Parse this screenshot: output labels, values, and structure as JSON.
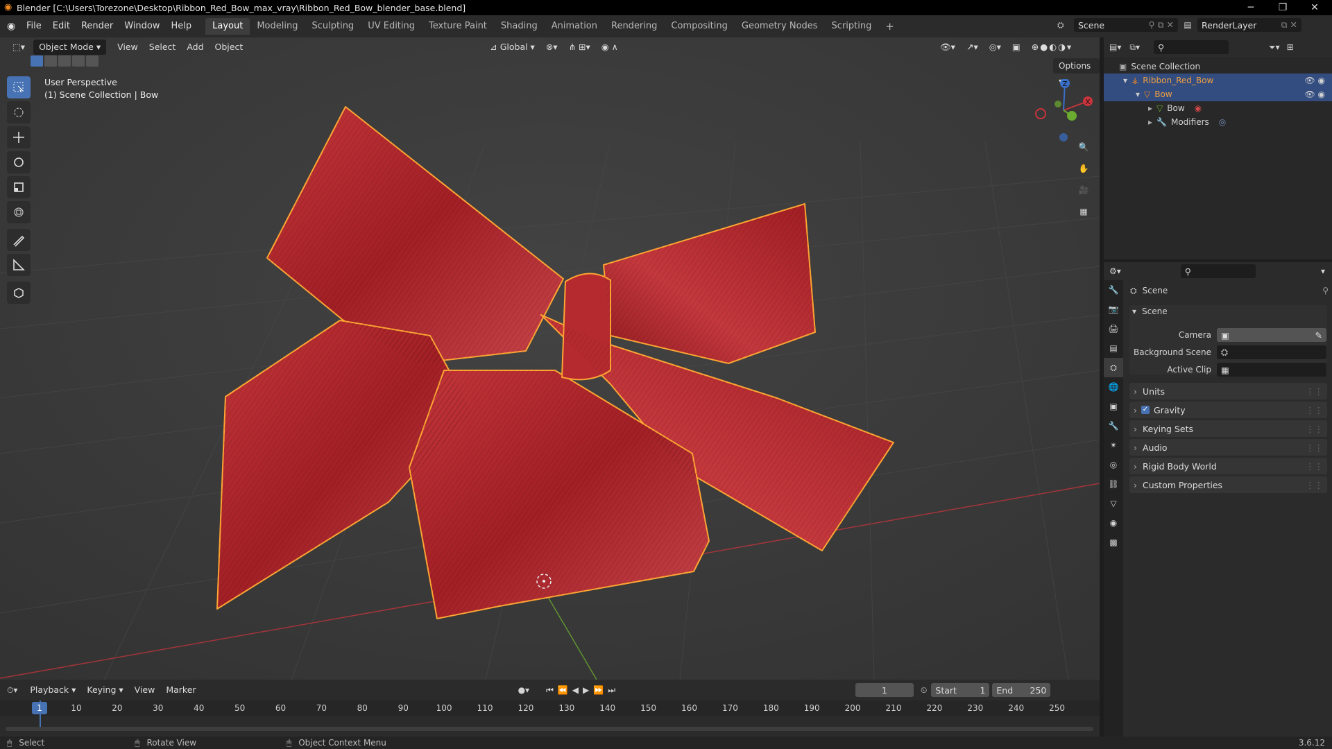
{
  "window": {
    "title": "Blender [C:\\Users\\Torezone\\Desktop\\Ribbon_Red_Bow_max_vray\\Ribbon_Red_Bow_blender_base.blend]"
  },
  "menus": [
    "File",
    "Edit",
    "Render",
    "Window",
    "Help"
  ],
  "workspaces": [
    "Layout",
    "Modeling",
    "Sculpting",
    "UV Editing",
    "Texture Paint",
    "Shading",
    "Animation",
    "Rendering",
    "Compositing",
    "Geometry Nodes",
    "Scripting"
  ],
  "active_workspace": "Layout",
  "scene_name": "Scene",
  "view_layer": "RenderLayer",
  "viewport": {
    "mode": "Object Mode",
    "menus": [
      "View",
      "Select",
      "Add",
      "Object"
    ],
    "orientation": "Global",
    "options": "Options",
    "overlay_title": "User Perspective",
    "overlay_sub": "(1) Scene Collection | Bow",
    "gizmo": {
      "x": "X",
      "y": "Y",
      "z": "Z"
    }
  },
  "outliner": {
    "root": "Scene Collection",
    "items": [
      {
        "label": "Ribbon_Red_Bow",
        "selected": true
      },
      {
        "label": "Bow",
        "selected": true
      },
      {
        "label": "Bow"
      },
      {
        "label": "Modifiers"
      }
    ]
  },
  "properties": {
    "header": "Scene",
    "section": "Scene",
    "fields": [
      {
        "label": "Camera",
        "value": ""
      },
      {
        "label": "Background Scene",
        "value": ""
      },
      {
        "label": "Active Clip",
        "value": ""
      }
    ],
    "panels": [
      "Units",
      "Gravity",
      "Keying Sets",
      "Audio",
      "Rigid Body World",
      "Custom Properties"
    ],
    "gravity_checked": true
  },
  "timeline": {
    "menus": [
      "Playback",
      "Keying",
      "View",
      "Marker"
    ],
    "current_frame": "1",
    "start_label": "Start",
    "start": "1",
    "end_label": "End",
    "end": "250",
    "ticks": [
      "1",
      "10",
      "20",
      "30",
      "40",
      "50",
      "60",
      "70",
      "80",
      "90",
      "100",
      "110",
      "120",
      "130",
      "140",
      "150",
      "160",
      "170",
      "180",
      "190",
      "200",
      "210",
      "220",
      "230",
      "240",
      "250"
    ]
  },
  "statusbar": {
    "select": "Select",
    "rotate": "Rotate View",
    "context": "Object Context Menu",
    "version": "3.6.12"
  },
  "colors": {
    "accent": "#4772b3",
    "selection": "#ffa533",
    "ribbon": "#b0262a",
    "x_axis": "#c8343c",
    "y_axis": "#6bab2f",
    "z_axis": "#3a6fc8"
  }
}
